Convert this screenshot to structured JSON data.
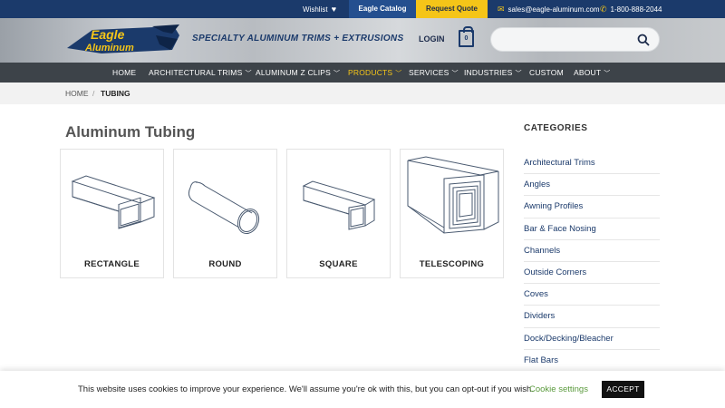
{
  "topbar": {
    "wishlist": "Wishlist",
    "catalog": "Eagle Catalog",
    "quote": "Request Quote",
    "email": "sales@eagle-aluminum.com",
    "phone": "1-800-888-2044"
  },
  "header": {
    "logo_text_top": "Eagle",
    "logo_text_bottom": "Aluminum",
    "tagline": "SPECIALTY ALUMINUM TRIMS + EXTRUSIONS",
    "login": "LOGIN",
    "cart_count": "0",
    "search_placeholder": ""
  },
  "nav": {
    "items": [
      {
        "label": "HOME"
      },
      {
        "label": "ARCHITECTURAL TRIMS"
      },
      {
        "label": "ALUMINUM Z CLIPS"
      },
      {
        "label": "PRODUCTS"
      },
      {
        "label": "SERVICES"
      },
      {
        "label": "INDUSTRIES"
      },
      {
        "label": "CUSTOM"
      },
      {
        "label": "ABOUT"
      }
    ]
  },
  "breadcrumb": {
    "home": "HOME",
    "separator": "/",
    "current": "TUBING"
  },
  "page": {
    "title": "Aluminum Tubing"
  },
  "products": [
    {
      "label": "RECTANGLE"
    },
    {
      "label": "ROUND"
    },
    {
      "label": "SQUARE"
    },
    {
      "label": "TELESCOPING"
    }
  ],
  "sidebar": {
    "title": "CATEGORIES",
    "items": [
      "Architectural Trims",
      "Angles",
      "Awning Profiles",
      "Bar & Face Nosing",
      "Channels",
      "Outside Corners",
      "Coves",
      "Dividers",
      "Dock/Decking/Bleacher",
      "Flat Bars"
    ]
  },
  "cookie": {
    "text": "This website uses cookies to improve your experience. We'll assume you're ok with this, but you can opt-out if you wish.",
    "settings": "Cookie settings",
    "accept": "ACCEPT"
  },
  "colors": {
    "navy": "#1b3a6b",
    "yellow": "#f5c518",
    "nav_bg": "#3d4349",
    "active_nav": "#f5c518"
  }
}
